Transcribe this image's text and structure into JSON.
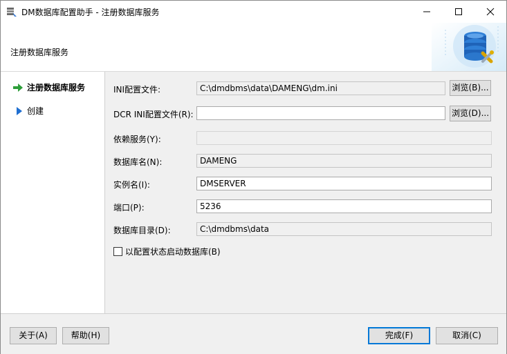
{
  "window": {
    "title": "DM数据库配置助手 - 注册数据库服务"
  },
  "header": {
    "title": "注册数据库服务"
  },
  "sidebar": {
    "steps": [
      {
        "label": "注册数据库服务",
        "active": true,
        "icon": "green-arrow-icon"
      },
      {
        "label": "创建",
        "active": false,
        "icon": "blue-triangle-icon"
      }
    ]
  },
  "form": {
    "ini_label": "INI配置文件:",
    "ini_value": "C:\\dmdbms\\data\\DAMENG\\dm.ini",
    "ini_browse": "浏览(B)...",
    "dcr_label": "DCR INI配置文件(R):",
    "dcr_value": "",
    "dcr_browse": "浏览(D)...",
    "dep_label": "依赖服务(Y):",
    "dep_value": "",
    "dbname_label": "数据库名(N):",
    "dbname_value": "DAMENG",
    "instance_label": "实例名(I):",
    "instance_value": "DMSERVER",
    "port_label": "端口(P):",
    "port_value": "5236",
    "dir_label": "数据库目录(D):",
    "dir_value": "C:\\dmdbms\\data",
    "config_start_label": "以配置状态启动数据库(B)",
    "config_start_checked": false
  },
  "footer": {
    "about": "关于(A)",
    "help": "帮助(H)",
    "finish": "完成(F)",
    "cancel": "取消(C)"
  },
  "colors": {
    "accent": "#0078d7",
    "step_arrow": "#2e9e3a",
    "step_triangle": "#1f6fd1"
  }
}
